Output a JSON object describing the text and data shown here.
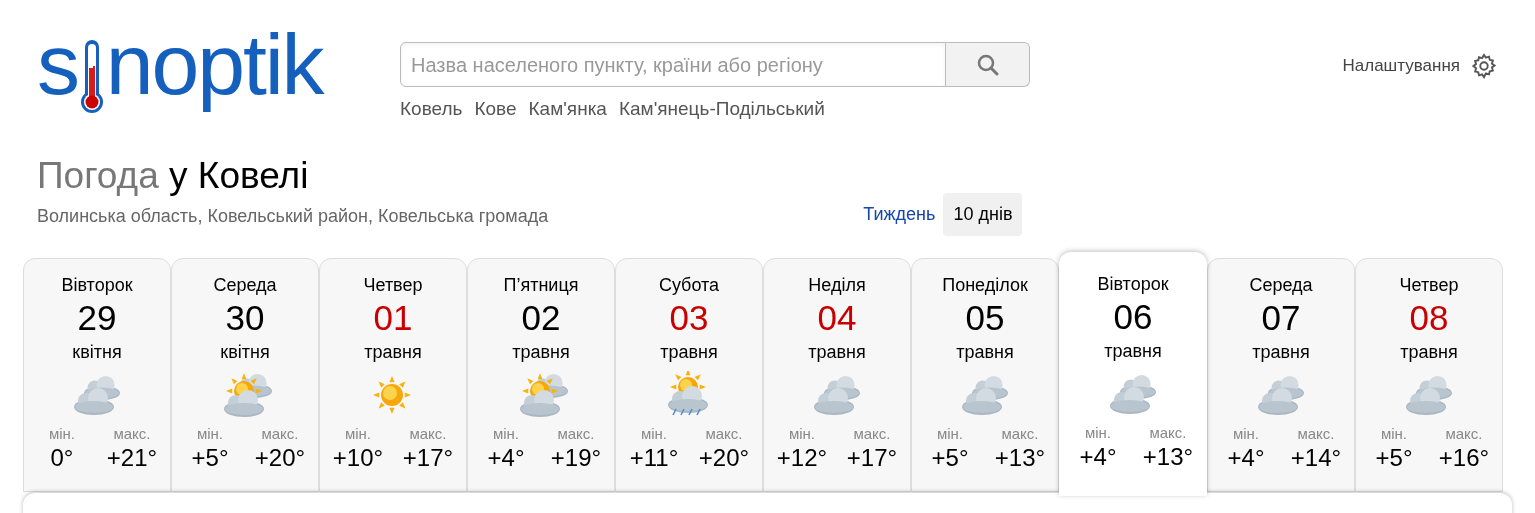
{
  "logo": {
    "before": "s",
    "after": "noptik"
  },
  "search": {
    "placeholder": "Назва населеного пункту, країни або регіону"
  },
  "suggestions": [
    "Ковель",
    "Кове",
    "Кам'янка",
    "Кам'янець-Подільський"
  ],
  "settings": {
    "label": "Налаштування"
  },
  "heading": {
    "prefix": "Погода",
    "city": "у Ковелі"
  },
  "region": "Волинська область, Ковельський район, Ковельська громада",
  "tabs": [
    {
      "label": "Тиждень",
      "selected": false
    },
    {
      "label": "10 днів",
      "selected": true
    }
  ],
  "days": [
    {
      "weekday": "Вівторок",
      "date": "29",
      "month": "квітня",
      "holiday": false,
      "kind": "cloudy",
      "min_label": "мін.",
      "min": "0°",
      "max_label": "макс.",
      "max": "+21°",
      "selected": false
    },
    {
      "weekday": "Середа",
      "date": "30",
      "month": "квітня",
      "holiday": false,
      "kind": "partly-cloudy",
      "min_label": "мін.",
      "min": "+5°",
      "max_label": "макс.",
      "max": "+20°",
      "selected": false
    },
    {
      "weekday": "Четвер",
      "date": "01",
      "month": "травня",
      "holiday": true,
      "kind": "sunny",
      "min_label": "мін.",
      "min": "+10°",
      "max_label": "макс.",
      "max": "+17°",
      "selected": false
    },
    {
      "weekday": "П’ятниця",
      "date": "02",
      "month": "травня",
      "holiday": false,
      "kind": "partly-cloudy",
      "min_label": "мін.",
      "min": "+4°",
      "max_label": "макс.",
      "max": "+19°",
      "selected": false
    },
    {
      "weekday": "Субота",
      "date": "03",
      "month": "травня",
      "holiday": true,
      "kind": "sun-rain",
      "min_label": "мін.",
      "min": "+11°",
      "max_label": "макс.",
      "max": "+20°",
      "selected": false
    },
    {
      "weekday": "Неділя",
      "date": "04",
      "month": "травня",
      "holiday": true,
      "kind": "cloudy",
      "min_label": "мін.",
      "min": "+12°",
      "max_label": "макс.",
      "max": "+17°",
      "selected": false
    },
    {
      "weekday": "Понеділок",
      "date": "05",
      "month": "травня",
      "holiday": false,
      "kind": "cloudy",
      "min_label": "мін.",
      "min": "+5°",
      "max_label": "макс.",
      "max": "+13°",
      "selected": false
    },
    {
      "weekday": "Вівторок",
      "date": "06",
      "month": "травня",
      "holiday": false,
      "kind": "cloudy",
      "min_label": "мін.",
      "min": "+4°",
      "max_label": "макс.",
      "max": "+13°",
      "selected": true
    },
    {
      "weekday": "Середа",
      "date": "07",
      "month": "травня",
      "holiday": false,
      "kind": "cloudy",
      "min_label": "мін.",
      "min": "+4°",
      "max_label": "макс.",
      "max": "+14°",
      "selected": false
    },
    {
      "weekday": "Четвер",
      "date": "08",
      "month": "травня",
      "holiday": true,
      "kind": "cloudy",
      "min_label": "мін.",
      "min": "+5°",
      "max_label": "макс.",
      "max": "+16°",
      "selected": false
    }
  ]
}
